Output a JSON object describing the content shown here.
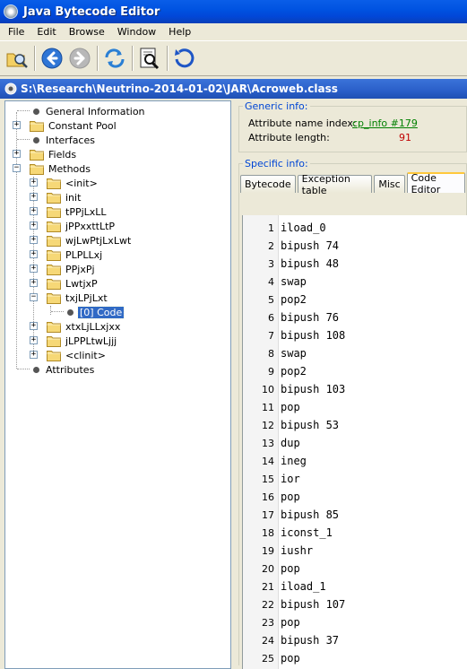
{
  "window": {
    "title": "Java Bytecode Editor"
  },
  "menu": {
    "items": [
      "File",
      "Edit",
      "Browse",
      "Window",
      "Help"
    ]
  },
  "toolbar": {
    "buttons": [
      "open-icon",
      "back-icon",
      "forward-icon",
      "refresh-icon",
      "search-icon",
      "reload-icon"
    ]
  },
  "path": {
    "text": "S:\\Research\\Neutrino-2014-01-02\\JAR\\Acroweb.class"
  },
  "tree": {
    "nodes": [
      {
        "label": "General Information",
        "type": "leaf",
        "level": 0
      },
      {
        "label": "Constant Pool",
        "type": "folder",
        "level": 0,
        "expander": "+"
      },
      {
        "label": "Interfaces",
        "type": "leaf",
        "level": 0
      },
      {
        "label": "Fields",
        "type": "folder",
        "level": 0,
        "expander": "+"
      },
      {
        "label": "Methods",
        "type": "folder",
        "level": 0,
        "expander": "-"
      },
      {
        "label": "<init>",
        "type": "folder",
        "level": 1,
        "expander": "+"
      },
      {
        "label": "init",
        "type": "folder",
        "level": 1,
        "expander": "+"
      },
      {
        "label": "tPPjLxLL",
        "type": "folder",
        "level": 1,
        "expander": "+"
      },
      {
        "label": "jPPxxttLtP",
        "type": "folder",
        "level": 1,
        "expander": "+"
      },
      {
        "label": "wjLwPtjLxLwt",
        "type": "folder",
        "level": 1,
        "expander": "+"
      },
      {
        "label": "PLPLLxj",
        "type": "folder",
        "level": 1,
        "expander": "+"
      },
      {
        "label": "PPjxPj",
        "type": "folder",
        "level": 1,
        "expander": "+"
      },
      {
        "label": "LwtjxP",
        "type": "folder",
        "level": 1,
        "expander": "+"
      },
      {
        "label": "txjLPjLxt",
        "type": "folder",
        "level": 1,
        "expander": "-"
      },
      {
        "label": "[0] Code",
        "type": "leaf",
        "level": 2,
        "selected": true
      },
      {
        "label": "xtxLjLLxjxx",
        "type": "folder",
        "level": 1,
        "expander": "+"
      },
      {
        "label": "jLPPLtwLjjj",
        "type": "folder",
        "level": 1,
        "expander": "+"
      },
      {
        "label": "<clinit>",
        "type": "folder",
        "level": 1,
        "expander": "+"
      },
      {
        "label": "Attributes",
        "type": "leaf",
        "level": 0
      }
    ]
  },
  "generic_info": {
    "title": "Generic info:",
    "name_index_label": "Attribute name index:",
    "name_index_value": "cp_info #179",
    "length_label": "Attribute length:",
    "length_value": "91"
  },
  "specific_info": {
    "title": "Specific info:",
    "tabs": [
      "Bytecode",
      "Exception table",
      "Misc",
      "Code Editor"
    ],
    "active_tab": "Code Editor"
  },
  "code": {
    "lines": [
      {
        "n": "1",
        "text": "iload_0"
      },
      {
        "n": "2",
        "text": "bipush 74"
      },
      {
        "n": "3",
        "text": "bipush 48"
      },
      {
        "n": "4",
        "text": "swap"
      },
      {
        "n": "5",
        "text": "pop2"
      },
      {
        "n": "6",
        "text": "bipush 76"
      },
      {
        "n": "7",
        "text": "bipush 108"
      },
      {
        "n": "8",
        "text": "swap"
      },
      {
        "n": "9",
        "text": "pop2"
      },
      {
        "n": "10",
        "text": "bipush 103"
      },
      {
        "n": "11",
        "text": "pop"
      },
      {
        "n": "12",
        "text": "bipush 53"
      },
      {
        "n": "13",
        "text": "dup"
      },
      {
        "n": "14",
        "text": "ineg"
      },
      {
        "n": "15",
        "text": "ior"
      },
      {
        "n": "16",
        "text": "pop"
      },
      {
        "n": "17",
        "text": "bipush 85"
      },
      {
        "n": "18",
        "text": "iconst_1"
      },
      {
        "n": "19",
        "text": "iushr"
      },
      {
        "n": "20",
        "text": "pop"
      },
      {
        "n": "21",
        "text": "iload_1"
      },
      {
        "n": "22",
        "text": "bipush 107"
      },
      {
        "n": "23",
        "text": "pop"
      },
      {
        "n": "24",
        "text": "bipush 37"
      },
      {
        "n": "25",
        "text": "pop"
      }
    ]
  }
}
